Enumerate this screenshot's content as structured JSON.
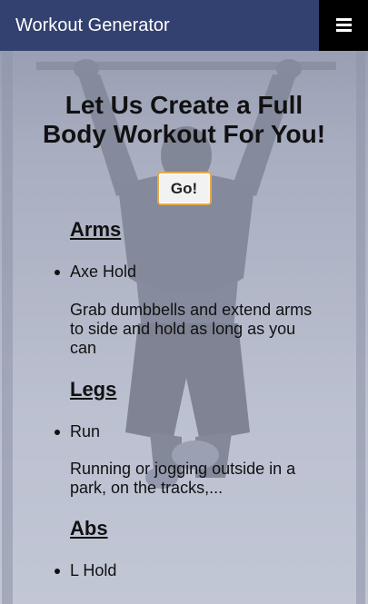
{
  "app": {
    "brand": "Workout Generator",
    "menu_icon": "hamburger-menu-icon"
  },
  "hero": {
    "title_line1": "Let Us Create a Full",
    "title_line2": "Body Workout For You!",
    "go_label": "Go!"
  },
  "sections": [
    {
      "heading": "Arms",
      "exercise": "Axe Hold",
      "desc_lines": [
        "Grab dumbbells and extend arms",
        "to side and hold as long as you",
        "can"
      ]
    },
    {
      "heading": "Legs",
      "exercise": "Run",
      "desc_lines": [
        "Running or jogging outside in a",
        "park, on the tracks,..."
      ]
    },
    {
      "heading": "Abs",
      "exercise": "L Hold"
    }
  ],
  "colors": {
    "navbar": "#334170",
    "menu_button": "#000000",
    "go_border": "#e5a944",
    "background_tint": "#c4c9d9"
  }
}
